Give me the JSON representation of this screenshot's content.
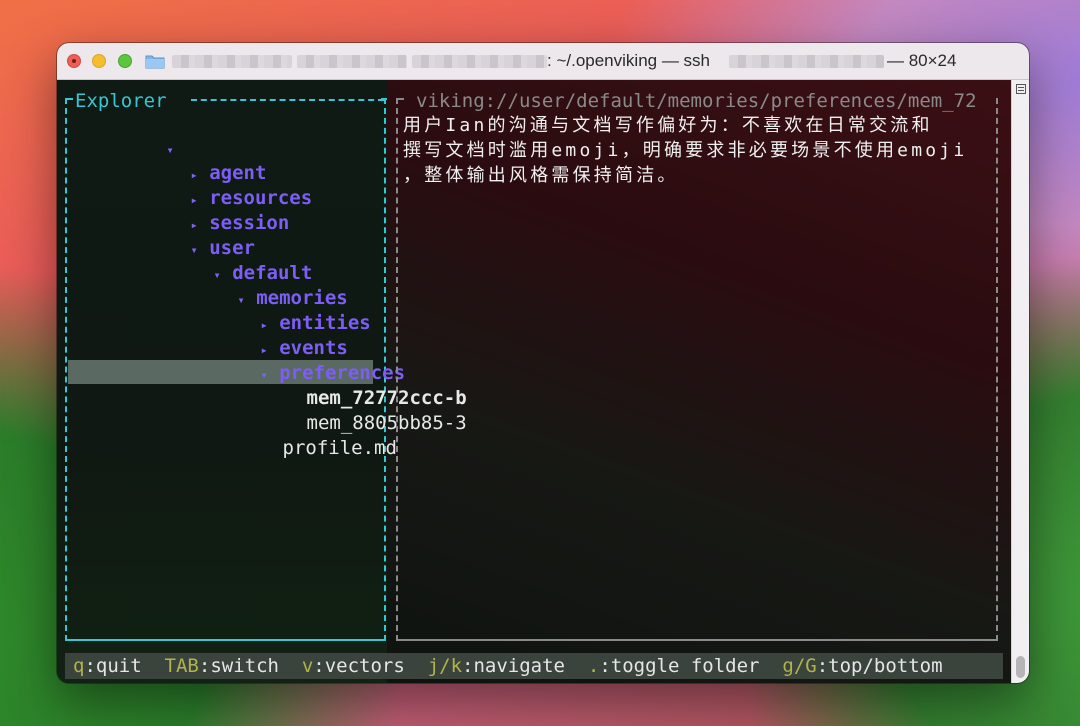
{
  "window": {
    "title": ": ~/.openviking — ssh",
    "size_label": "— 80×24"
  },
  "explorer": {
    "title": "Explorer",
    "root_arrow": "▾",
    "items": [
      {
        "arrow": "▸",
        "label": "agent",
        "kind": "dir",
        "depth": 1
      },
      {
        "arrow": "▸",
        "label": "resources",
        "kind": "dir",
        "depth": 1
      },
      {
        "arrow": "▸",
        "label": "session",
        "kind": "dir",
        "depth": 1
      },
      {
        "arrow": "▾",
        "label": "user",
        "kind": "dir",
        "depth": 1
      },
      {
        "arrow": "▾",
        "label": "default",
        "kind": "dir",
        "depth": 2
      },
      {
        "arrow": "▾",
        "label": "memories",
        "kind": "dir",
        "depth": 3
      },
      {
        "arrow": "▸",
        "label": "entities",
        "kind": "dir",
        "depth": 4
      },
      {
        "arrow": "▸",
        "label": "events",
        "kind": "dir",
        "depth": 4
      },
      {
        "arrow": "▾",
        "label": "preferences",
        "kind": "dir",
        "depth": 4
      },
      {
        "arrow": "",
        "label": "mem_72772ccc-b",
        "kind": "file",
        "depth": 5,
        "selected": true
      },
      {
        "arrow": "",
        "label": "mem_8805bb85-3",
        "kind": "file",
        "depth": 5
      },
      {
        "arrow": "",
        "label": "profile.md",
        "kind": "file",
        "depth": 4
      }
    ]
  },
  "preview": {
    "path": "viking://user/default/memories/preferences/mem_72",
    "lines": [
      "用户Ian的沟通与文档写作偏好为：不喜欢在日常交流和",
      "撰写文档时滥用emoji，明确要求非必要场景不使用emoji",
      "，整体输出风格需保持简洁。"
    ]
  },
  "status_bar": [
    {
      "key": "q",
      "action": ":quit"
    },
    {
      "key": "TAB",
      "action": ":switch"
    },
    {
      "key": "v",
      "action": ":vectors"
    },
    {
      "key": "j/k",
      "action": ":navigate"
    },
    {
      "key": ".",
      "action": ":toggle folder"
    },
    {
      "key": "g/G",
      "action": ":top/bottom"
    }
  ],
  "colors": {
    "border_cyan": "#38c6d3",
    "dir_purple": "#7c5ef5",
    "status_key": "#b0b44a",
    "selection": "#5a6a62"
  },
  "icons": {
    "folder": "folder-icon",
    "menu": "terminal-menu-icon"
  }
}
